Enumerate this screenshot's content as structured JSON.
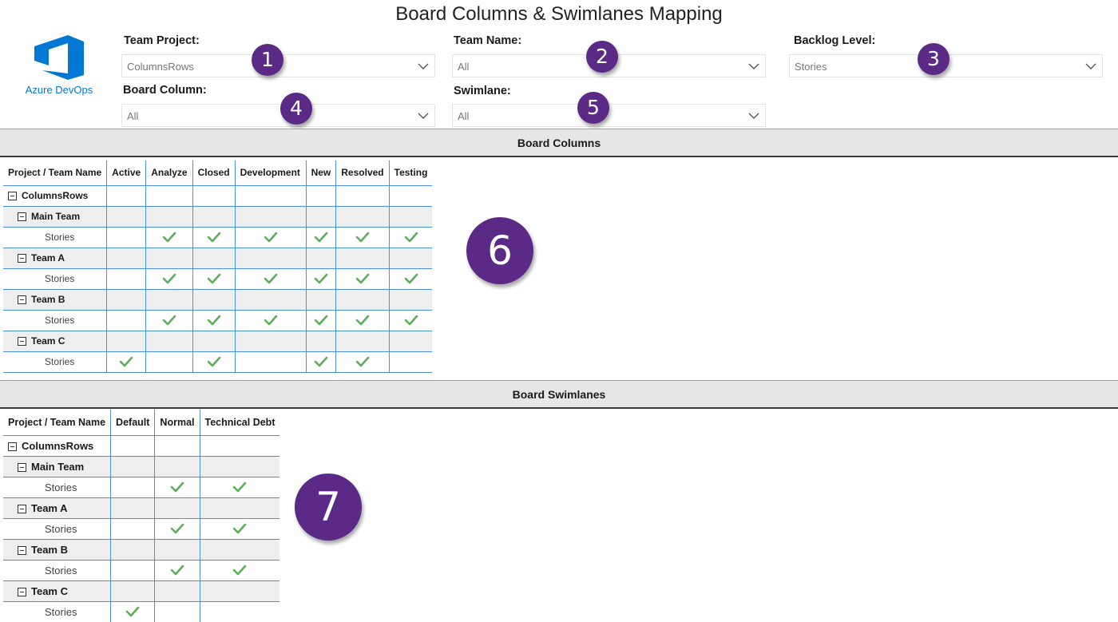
{
  "title": "Board Columns & Swimlanes Mapping",
  "logo": {
    "text": "Azure DevOps",
    "icon": "azure-devops-icon",
    "color": "#0078d4"
  },
  "filters": {
    "team_project": {
      "label": "Team Project:",
      "value": "ColumnsRows"
    },
    "team_name": {
      "label": "Team Name:",
      "value": "All"
    },
    "backlog_level": {
      "label": "Backlog Level:",
      "value": "Stories"
    },
    "board_column": {
      "label": "Board Column:",
      "value": "All"
    },
    "swimlane": {
      "label": "Swimlane:",
      "value": "All"
    }
  },
  "badges": [
    "1",
    "2",
    "3",
    "4",
    "5",
    "6",
    "7"
  ],
  "colors": {
    "badge": "#5b2a86",
    "check": "#5cae5c",
    "grid": "#4a90d9",
    "team_row": "#eeeeee"
  },
  "board_columns": {
    "section_title": "Board Columns",
    "header_name": "Project / Team Name",
    "columns": [
      "Active",
      "Analyze",
      "Closed",
      "Development",
      "New",
      "Resolved",
      "Testing"
    ],
    "rows": [
      {
        "type": "proj",
        "name": "ColumnsRows",
        "checks": [
          0,
          0,
          0,
          0,
          0,
          0,
          0
        ]
      },
      {
        "type": "team",
        "name": "Main Team",
        "checks": [
          0,
          0,
          0,
          0,
          0,
          0,
          0
        ]
      },
      {
        "type": "leaf",
        "name": "Stories",
        "checks": [
          0,
          1,
          1,
          1,
          1,
          1,
          1
        ]
      },
      {
        "type": "team",
        "name": "Team A",
        "checks": [
          0,
          0,
          0,
          0,
          0,
          0,
          0
        ]
      },
      {
        "type": "leaf",
        "name": "Stories",
        "checks": [
          0,
          1,
          1,
          1,
          1,
          1,
          1
        ]
      },
      {
        "type": "team",
        "name": "Team B",
        "checks": [
          0,
          0,
          0,
          0,
          0,
          0,
          0
        ]
      },
      {
        "type": "leaf",
        "name": "Stories",
        "checks": [
          0,
          1,
          1,
          1,
          1,
          1,
          1
        ]
      },
      {
        "type": "team",
        "name": "Team C",
        "checks": [
          0,
          0,
          0,
          0,
          0,
          0,
          0
        ]
      },
      {
        "type": "leaf",
        "name": "Stories",
        "checks": [
          1,
          0,
          1,
          0,
          1,
          1,
          0
        ]
      }
    ]
  },
  "board_swimlanes": {
    "section_title": "Board Swimlanes",
    "header_name": "Project / Team Name",
    "columns": [
      "Default",
      "Normal",
      "Technical Debt"
    ],
    "rows": [
      {
        "type": "proj",
        "name": "ColumnsRows",
        "checks": [
          0,
          0,
          0
        ]
      },
      {
        "type": "team",
        "name": "Main Team",
        "checks": [
          0,
          0,
          0
        ]
      },
      {
        "type": "leaf",
        "name": "Stories",
        "checks": [
          0,
          1,
          1
        ]
      },
      {
        "type": "team",
        "name": "Team A",
        "checks": [
          0,
          0,
          0
        ]
      },
      {
        "type": "leaf",
        "name": "Stories",
        "checks": [
          0,
          1,
          1
        ]
      },
      {
        "type": "team",
        "name": "Team B",
        "checks": [
          0,
          0,
          0
        ]
      },
      {
        "type": "leaf",
        "name": "Stories",
        "checks": [
          0,
          1,
          1
        ]
      },
      {
        "type": "team",
        "name": "Team C",
        "checks": [
          0,
          0,
          0
        ]
      },
      {
        "type": "leaf",
        "name": "Stories",
        "checks": [
          1,
          0,
          0
        ]
      }
    ]
  }
}
